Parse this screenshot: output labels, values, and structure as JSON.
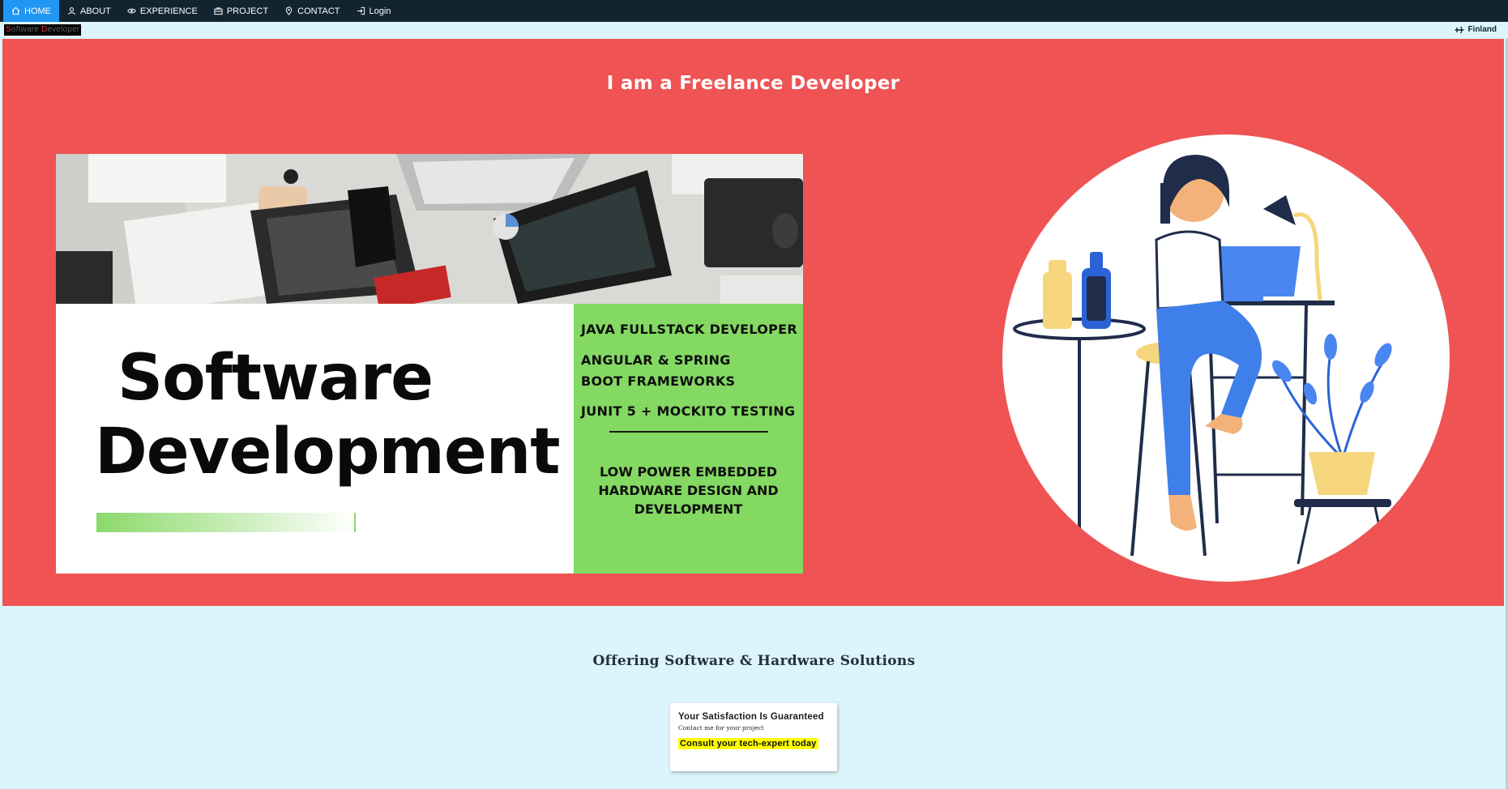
{
  "nav": {
    "items": [
      {
        "label": "HOME",
        "icon": "home-icon",
        "active": true
      },
      {
        "label": "ABOUT",
        "icon": "user-icon"
      },
      {
        "label": "EXPERIENCE",
        "icon": "eye-icon"
      },
      {
        "label": "PROJECT",
        "icon": "briefcase-icon"
      },
      {
        "label": "CONTACT",
        "icon": "map-pin-icon"
      },
      {
        "label": "Login",
        "icon": "login-icon"
      }
    ]
  },
  "brand": {
    "first": "S",
    "part1": "oftware ",
    "second": "D",
    "part2": "eveloper"
  },
  "location": {
    "label": "Finland",
    "icon": "plane-icon"
  },
  "hero": {
    "title": "I am a Freelance Developer",
    "card": {
      "title_line1": "Software",
      "title_line2": "Development",
      "skills": [
        "JAVA FULLSTACK DEVELOPER",
        "ANGULAR & SPRING BOOT FRAMEWORKS",
        "JUNIT 5 + MOCKITO TESTING"
      ],
      "hardware": "LOW POWER EMBEDDED HARDWARE DESIGN AND DEVELOPMENT"
    }
  },
  "offer": {
    "subtitle": "Offering Software & Hardware Solutions",
    "cta_heading": "Your Satisfaction Is Guaranteed",
    "cta_sub": "Contact me for your project",
    "cta_button": "Consult your tech-expert today"
  },
  "colors": {
    "navbar": "#11242f",
    "nav_active": "#2196f3",
    "hero_bg": "#ef5353",
    "panel_green": "#83d962",
    "page_bg": "#dcf4fb",
    "highlight": "#ffff00"
  }
}
